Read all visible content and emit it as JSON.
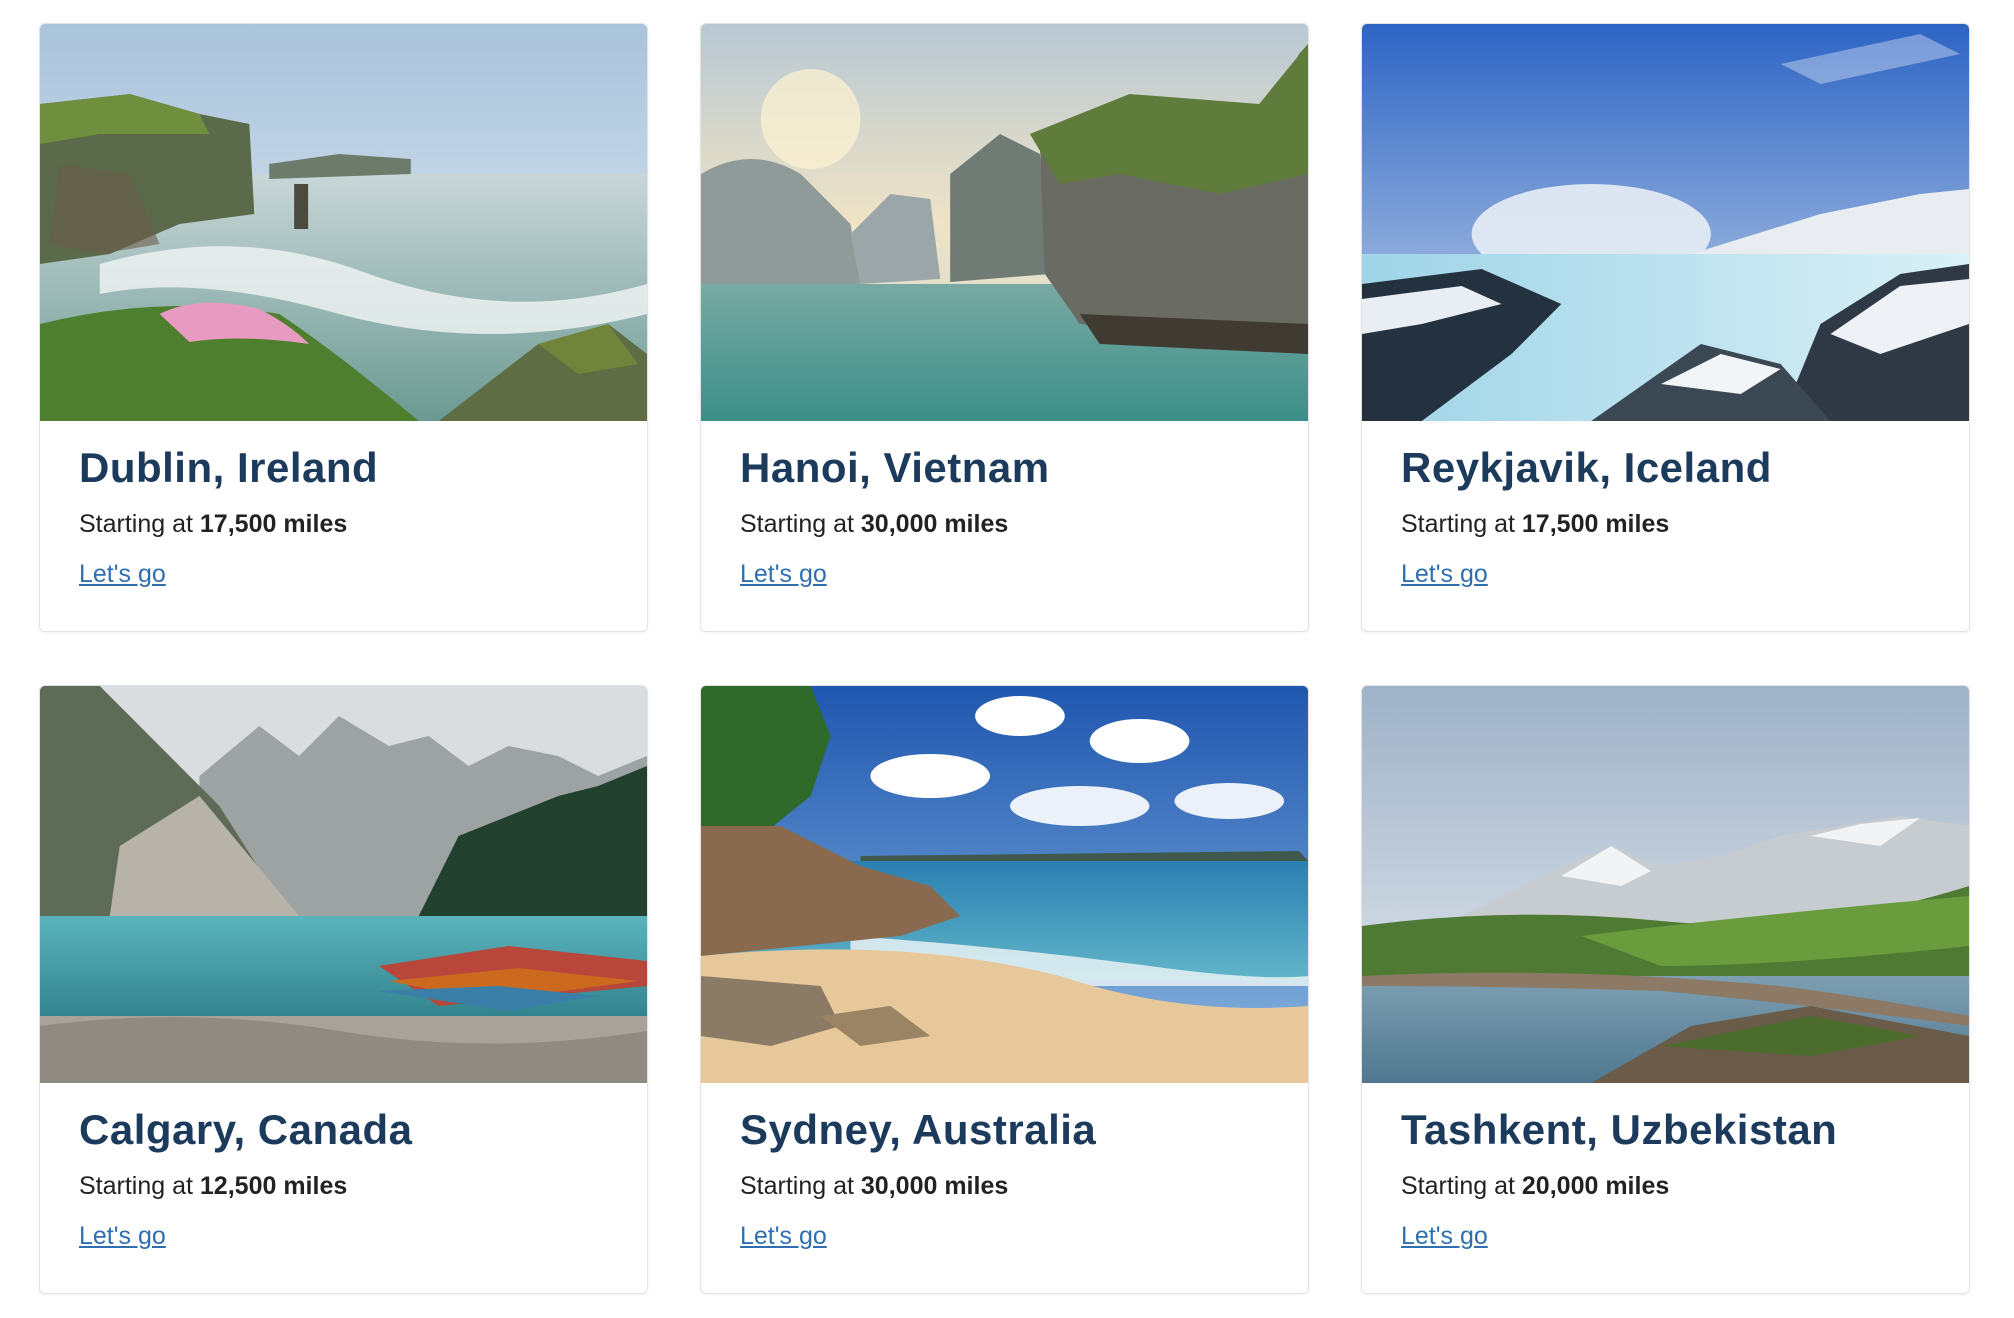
{
  "cards": [
    {
      "city": "Dublin, Ireland",
      "price_prefix": "Starting at",
      "price": "17,500 miles",
      "cta": "Let's go"
    },
    {
      "city": "Hanoi, Vietnam",
      "price_prefix": "Starting at",
      "price": "30,000 miles",
      "cta": "Let's go"
    },
    {
      "city": "Reykjavik, Iceland",
      "price_prefix": "Starting at",
      "price": "17,500 miles",
      "cta": "Let's go"
    },
    {
      "city": "Calgary, Canada",
      "price_prefix": "Starting at",
      "price": "12,500 miles",
      "cta": "Let's go"
    },
    {
      "city": "Sydney, Australia",
      "price_prefix": "Starting at",
      "price": "30,000 miles",
      "cta": "Let's go"
    },
    {
      "city": "Tashkent, Uzbekistan",
      "price_prefix": "Starting at",
      "price": "20,000 miles",
      "cta": "Let's go"
    }
  ],
  "colors": {
    "title": "#1b3a5c",
    "link": "#2f6fb0",
    "border": "#e3e3e3"
  }
}
